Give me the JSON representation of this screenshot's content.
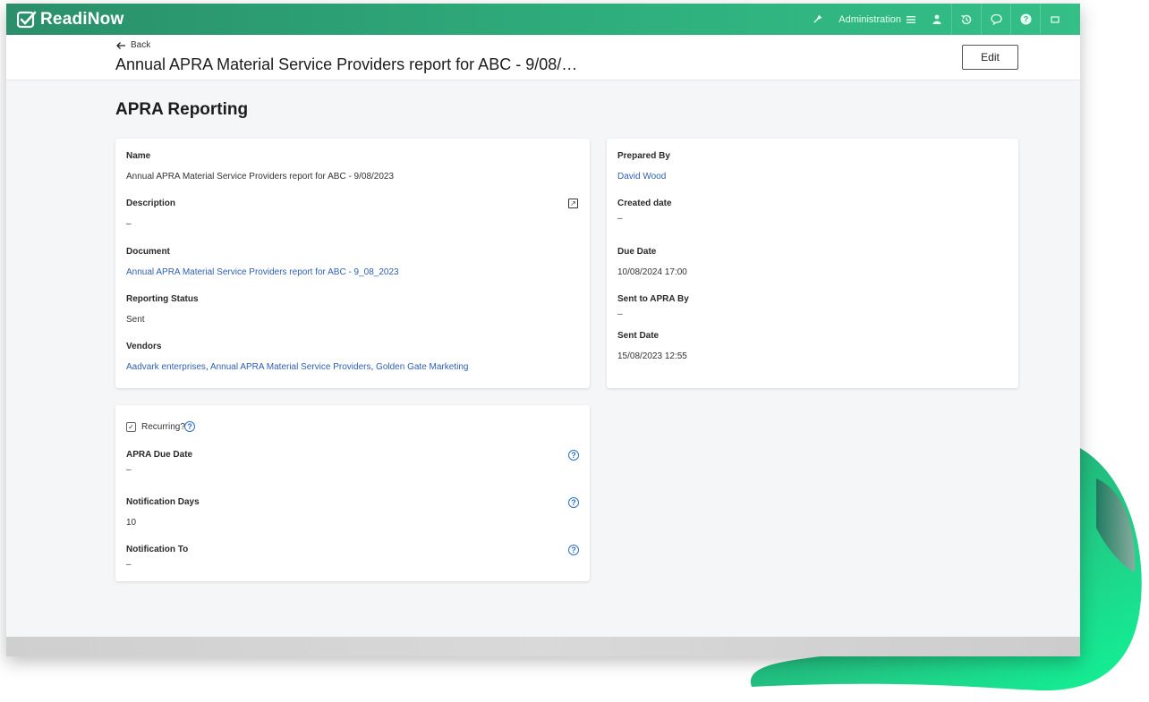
{
  "app": {
    "name": "ReadiNow"
  },
  "topbar": {
    "admin_label": "Administration"
  },
  "header": {
    "back_label": "Back",
    "title": "Annual APRA Material Service Providers report for ABC - 9/08/…",
    "edit_label": "Edit"
  },
  "section_title": "APRA Reporting",
  "left_card": {
    "name_label": "Name",
    "name_value": "Annual APRA Material Service Providers report for ABC - 9/08/2023",
    "description_label": "Description",
    "description_value": "–",
    "document_label": "Document",
    "document_value": "Annual APRA Material Service Providers report for ABC - 9_08_2023",
    "status_label": "Reporting Status",
    "status_value": "Sent",
    "vendors_label": "Vendors",
    "vendors": [
      "Aadvark enterprises",
      "Annual APRA Material Service Providers",
      "Golden Gate Marketing"
    ]
  },
  "right_card": {
    "prepared_label": "Prepared By",
    "prepared_value": "David Wood",
    "created_label": "Created date",
    "created_value": "–",
    "due_label": "Due Date",
    "due_value": "10/08/2024 17:00",
    "sent_by_label": "Sent to APRA By",
    "sent_by_value": "–",
    "sent_date_label": "Sent Date",
    "sent_date_value": "15/08/2023 12:55"
  },
  "recurring_card": {
    "recurring_label": "Recurring?",
    "recurring_checked": true,
    "apra_due_label": "APRA Due Date",
    "apra_due_value": "–",
    "notif_days_label": "Notification Days",
    "notif_days_value": "10",
    "notif_to_label": "Notification To",
    "notif_to_value": "–"
  },
  "colors": {
    "brand": "#2fb07e",
    "link": "#2f5fb3",
    "help": "#2f6fc6"
  }
}
